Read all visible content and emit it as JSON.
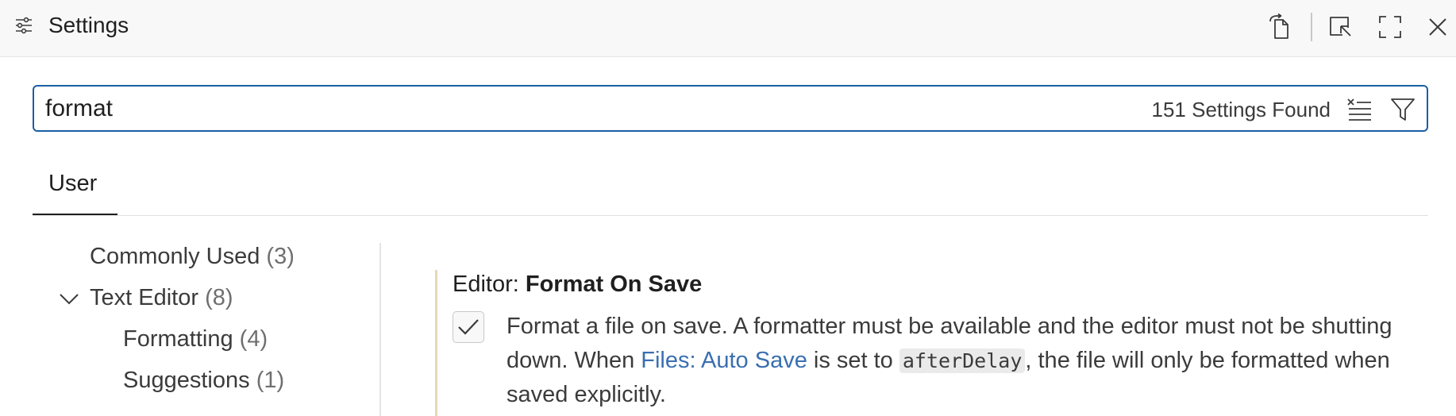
{
  "titlebar": {
    "icon": "settings-sliders-icon",
    "title": "Settings",
    "buttons": [
      "open-settings-json-icon",
      "select-element-icon",
      "maximize-icon",
      "close-icon"
    ]
  },
  "search": {
    "value": "format",
    "placeholder": "",
    "results_count": "151 Settings Found"
  },
  "tabs": [
    {
      "label": "User",
      "active": true
    }
  ],
  "toc": {
    "items": [
      {
        "label": "Commonly Used",
        "count": "(3)"
      },
      {
        "label": "Text Editor",
        "count": "(8)",
        "expanded": true
      },
      {
        "label": "Formatting",
        "count": "(4)"
      },
      {
        "label": "Suggestions",
        "count": "(1)"
      }
    ]
  },
  "setting": {
    "category": "Editor: ",
    "name": "Format On Save",
    "checked": true,
    "desc_part1": "Format a file on save. A formatter must be available and the editor must not be shutting down. When ",
    "link": "Files: Auto Save",
    "desc_part2": " is set to ",
    "code": "afterDelay",
    "desc_part3": ", the file will only be formatted when saved explicitly."
  },
  "colors": {
    "accent": "#1a5fa6",
    "link": "#3a6fb0",
    "modified_indicator": "#e8d8b8"
  }
}
